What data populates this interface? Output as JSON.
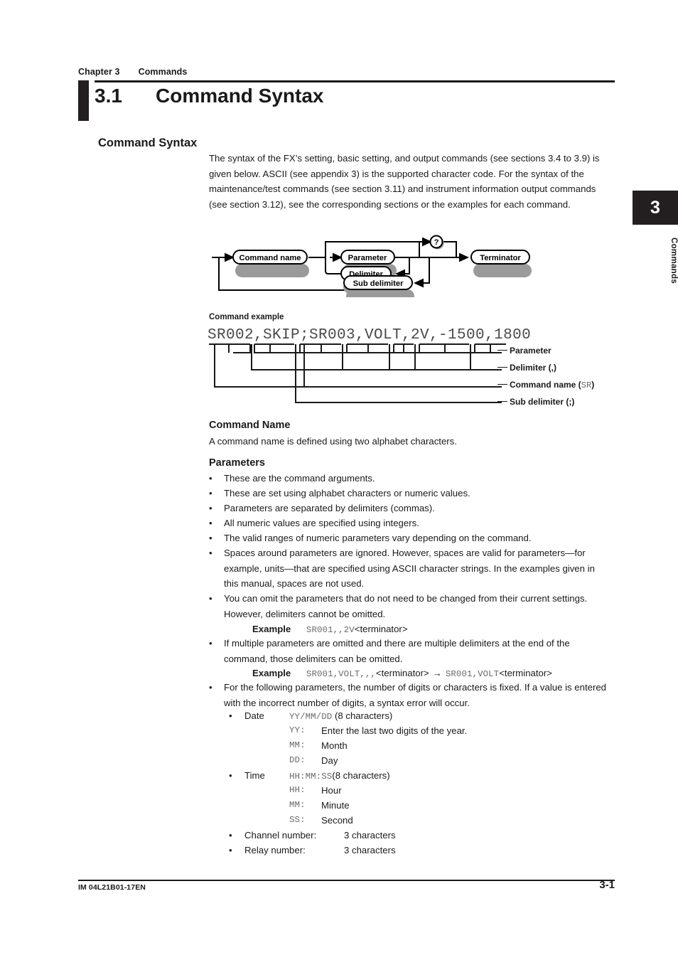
{
  "header": {
    "chapter": "Chapter 3",
    "chapter_title": "Commands",
    "section_number": "3.1",
    "section_title": "Command Syntax"
  },
  "side_tab": {
    "number": "3",
    "label": "Commands"
  },
  "sub_heading": "Command Syntax",
  "intro_paragraph": "The syntax of the FX’s setting, basic setting, and output commands (see sections 3.4 to 3.9) is given below. ASCII (see appendix 3) is the supported character code. For the syntax of the maintenance/test commands (see section 3.11) and instrument information output commands (see section 3.12), see the corresponding sections or the examples for each command.",
  "syntax_diagram": {
    "nodes": [
      "Command name",
      "Parameter",
      "Delimiter",
      "Sub delimiter",
      "Terminator"
    ],
    "query_symbol": "?"
  },
  "command_example": {
    "label": "Command example",
    "code": "SR002,SKIP;SR003,VOLT,2V,-1500,1800",
    "callouts": [
      {
        "text": "Parameter",
        "mono": ""
      },
      {
        "text": "Delimiter (,)",
        "mono": ""
      },
      {
        "text": "Command name (",
        "mono": "SR",
        "tail": ")"
      },
      {
        "text": "Sub delimiter (;)",
        "mono": ""
      }
    ],
    "callout_parameter": "Parameter",
    "callout_delimiter": "Delimiter (,)",
    "callout_command_name_pre": "Command name (",
    "callout_command_name_mono": "SR",
    "callout_command_name_post": ")",
    "callout_sub_delimiter": "Sub delimiter (;)"
  },
  "command_name": {
    "heading": "Command Name",
    "text": "A command name is defined using two alphabet characters."
  },
  "parameters": {
    "heading": "Parameters",
    "bullets": [
      "These are the command arguments.",
      "These are set using alphabet characters or numeric values.",
      "Parameters are separated by delimiters (commas).",
      "All numeric values are specified using integers.",
      "The valid ranges of numeric parameters vary depending on the command.",
      "Spaces around parameters are ignored. However, spaces are valid for parameters—for example, units—that are specified using ASCII character strings. In the examples given in this manual, spaces are not used.",
      "You can omit the parameters that do not need to be changed from their current settings. However, delimiters cannot be omitted.",
      "If multiple parameters are omitted and there are multiple delimiters at the end of the command, those delimiters can be omitted.",
      "For the following parameters, the number of digits or characters is fixed. If a value is entered with the incorrect number of digits, a syntax error will occur."
    ],
    "example1": {
      "label": "Example",
      "mono": "SR001,,2V",
      "plain": "<terminator>"
    },
    "example2": {
      "label": "Example",
      "mono1": "SR001,VOLT,,,",
      "plain1": "<terminator>",
      "arrow": "→",
      "mono2": "SR001,VOLT",
      "plain2": "<terminator>"
    },
    "fixed_items": [
      {
        "bullet": "Date",
        "format": "YY/MM/DD",
        "note": " (8 characters)",
        "defs": [
          {
            "key": "YY:",
            "value": "Enter the last two digits of the year."
          },
          {
            "key": "MM:",
            "value": "Month"
          },
          {
            "key": "DD:",
            "value": "Day"
          }
        ]
      },
      {
        "bullet": "Time",
        "format": "HH:MM:SS",
        "note": "(8 characters)",
        "defs": [
          {
            "key": "HH:",
            "value": "Hour"
          },
          {
            "key": "MM:",
            "value": "Minute"
          },
          {
            "key": "SS:",
            "value": "Second"
          }
        ]
      }
    ],
    "char_counts": [
      {
        "label": "Channel number:",
        "value": "3 characters"
      },
      {
        "label": "Relay number:",
        "value": "3 characters"
      }
    ]
  },
  "footer": {
    "doc_id": "IM 04L21B01-17EN",
    "page": "3-1"
  },
  "bullet_glyph": "•"
}
